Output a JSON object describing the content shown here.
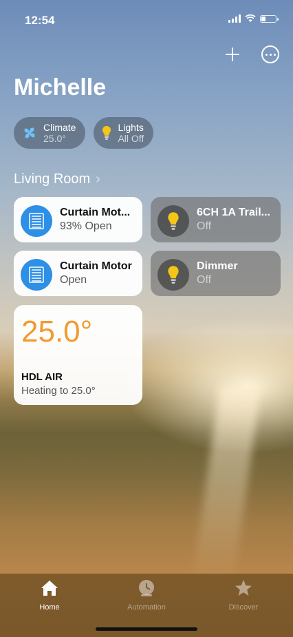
{
  "status_bar": {
    "time": "12:54"
  },
  "header": {
    "title": "Michelle"
  },
  "chips": [
    {
      "title": "Climate",
      "subtitle": "25.0°",
      "icon": "fan-icon"
    },
    {
      "title": "Lights",
      "subtitle": "All Off",
      "icon": "lightbulb-icon"
    }
  ],
  "room": {
    "title": "Living Room"
  },
  "tiles": [
    {
      "name": "Curtain Mot...",
      "state": "93% Open",
      "icon": "blinds-icon"
    },
    {
      "name": "6CH 1A Trail...",
      "state": "Off",
      "icon": "lightbulb-icon"
    },
    {
      "name": "Curtain Motor",
      "state": "Open",
      "icon": "blinds-icon"
    },
    {
      "name": "Dimmer",
      "state": "Off",
      "icon": "lightbulb-icon"
    }
  ],
  "thermostat": {
    "temperature": "25.0°",
    "name": "HDL AIR",
    "state": "Heating to 25.0°"
  },
  "tabs": [
    {
      "label": "Home",
      "icon": "house-icon",
      "active": true
    },
    {
      "label": "Automation",
      "icon": "clock-icon",
      "active": false
    },
    {
      "label": "Discover",
      "icon": "star-icon",
      "active": false
    }
  ],
  "colors": {
    "accent_orange": "#f29a2e",
    "blue": "#2e8fe6",
    "bulb_yellow": "#f5c518"
  }
}
